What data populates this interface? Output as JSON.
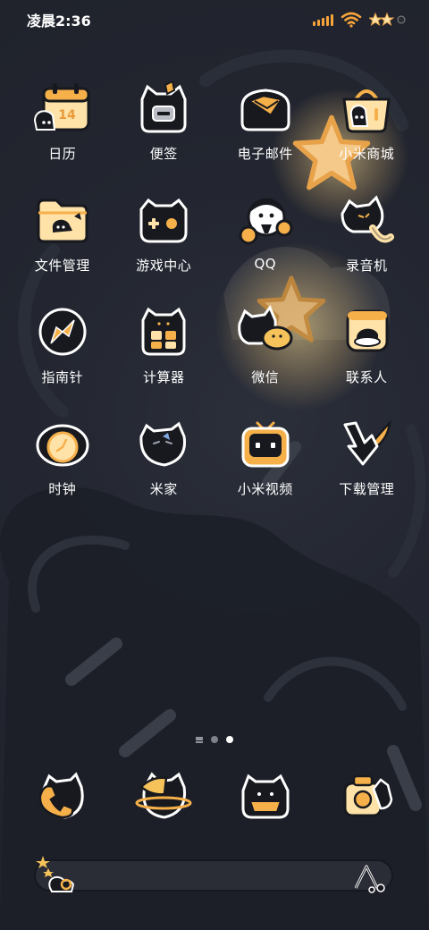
{
  "status_bar": {
    "time": "凌晨2:36"
  },
  "apps": [
    {
      "label": "日历",
      "icon": "calendar-icon"
    },
    {
      "label": "便签",
      "icon": "notes-icon"
    },
    {
      "label": "电子邮件",
      "icon": "email-icon"
    },
    {
      "label": "小米商城",
      "icon": "shopping-basket-icon"
    },
    {
      "label": "文件管理",
      "icon": "folder-icon"
    },
    {
      "label": "游戏中心",
      "icon": "gamepad-icon"
    },
    {
      "label": "QQ",
      "icon": "penguin-icon"
    },
    {
      "label": "录音机",
      "icon": "microphone-icon"
    },
    {
      "label": "指南针",
      "icon": "compass-icon"
    },
    {
      "label": "计算器",
      "icon": "calculator-icon"
    },
    {
      "label": "微信",
      "icon": "chat-icon"
    },
    {
      "label": "联系人",
      "icon": "contacts-icon"
    },
    {
      "label": "时钟",
      "icon": "clock-icon"
    },
    {
      "label": "米家",
      "icon": "home-icon"
    },
    {
      "label": "小米视频",
      "icon": "tv-icon"
    },
    {
      "label": "下载管理",
      "icon": "download-arrow-icon"
    }
  ],
  "page_indicator": {
    "pages": 2,
    "active": 2
  },
  "dock": [
    {
      "icon": "phone-icon"
    },
    {
      "icon": "browser-icon"
    },
    {
      "icon": "messages-icon"
    },
    {
      "icon": "camera-icon"
    }
  ],
  "colors": {
    "accent": "#f6b04a",
    "cream": "#ffe2a8",
    "dark": "#17191f",
    "background": "#232630"
  }
}
